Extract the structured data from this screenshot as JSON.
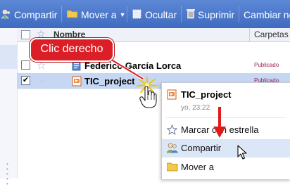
{
  "toolbar": {
    "share_label": "Compartir",
    "move_label": "Mover a",
    "hide_label": "Ocultar",
    "delete_label": "Suprimir",
    "change_label": "Cambiar no"
  },
  "table": {
    "header": {
      "name": "Nombre",
      "folders": "Carpetas"
    },
    "rows": [
      {
        "title": "Federico García Lorca",
        "status": "Publicado",
        "checked": false
      },
      {
        "title": "TIC_project",
        "status": "Publicado",
        "checked": true
      }
    ]
  },
  "callout": {
    "text": "Clic derecho"
  },
  "context_menu": {
    "title": "TIC_project",
    "time": "yo, 23:22",
    "items": [
      {
        "label": "Marcar con estrella",
        "icon": "star-icon"
      },
      {
        "label": "Compartir",
        "icon": "share-icon",
        "highlighted": true
      },
      {
        "label": "Mover a",
        "icon": "folder-icon"
      }
    ]
  },
  "colors": {
    "toolbar": "#4b77c9",
    "selected_row": "#c6d7f3",
    "callout": "#dc1e26",
    "status": "#9c2350",
    "menu_highlight": "#dbe6f6"
  }
}
